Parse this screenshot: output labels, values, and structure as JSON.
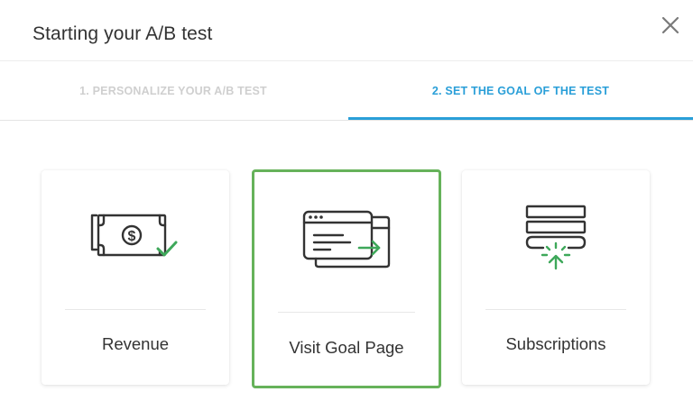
{
  "modal": {
    "title": "Starting your A/B test",
    "close_icon": "close-icon"
  },
  "tabs": [
    {
      "label": "1. PERSONALIZE YOUR A/B TEST",
      "active": false
    },
    {
      "label": "2. SET THE GOAL OF THE TEST",
      "active": true
    }
  ],
  "goals": [
    {
      "label": "Revenue",
      "icon": "money-check-icon",
      "selected": false
    },
    {
      "label": "Visit Goal Page",
      "icon": "browser-windows-arrow-icon",
      "selected": true
    },
    {
      "label": "Subscriptions",
      "icon": "subscription-form-icon",
      "selected": false
    }
  ],
  "colors": {
    "accent_blue": "#2a9fd8",
    "selected_green": "#66b25a",
    "icon_green": "#3ea85a",
    "icon_dark": "#333333",
    "inactive_tab": "#cfcfcf"
  }
}
